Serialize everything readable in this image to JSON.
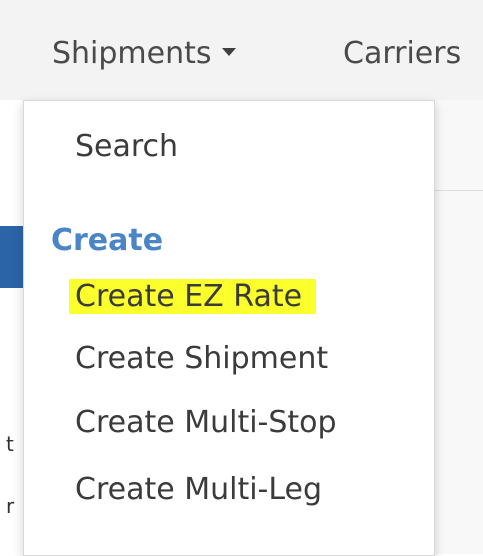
{
  "nav": {
    "shipments_label": "Shipments",
    "carriers_label": "Carriers"
  },
  "dropdown": {
    "search_label": "Search",
    "create_header": "Create",
    "items": [
      {
        "label": "Create EZ Rate",
        "highlighted": true
      },
      {
        "label": "Create Shipment",
        "highlighted": false
      },
      {
        "label": "Create Multi-Stop",
        "highlighted": false
      },
      {
        "label": "Create Multi-Leg",
        "highlighted": false
      }
    ]
  },
  "background": {
    "frag_1": "t",
    "frag_2": "r"
  },
  "colors": {
    "accent": "#4a86c5",
    "highlight": "#fbff2b",
    "bar": "#2b65a8"
  }
}
